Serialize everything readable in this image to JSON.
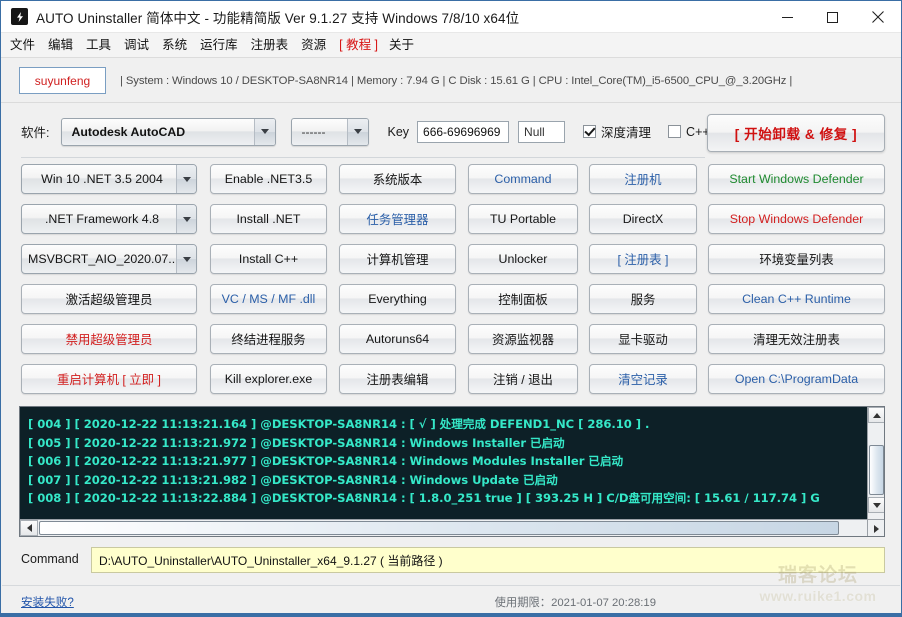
{
  "window": {
    "title": "AUTO Uninstaller 简体中文 - 功能精简版 Ver 9.1.27 支持 Windows 7/8/10 x64位",
    "icon": "lightning-bolt-icon",
    "minimize_label": "minimize-icon",
    "maximize_label": "maximize-icon",
    "close_label": "close-icon"
  },
  "menubar": {
    "items": [
      {
        "label": "文件",
        "accent": false
      },
      {
        "label": "编辑",
        "accent": false
      },
      {
        "label": "工具",
        "accent": false
      },
      {
        "label": "调试",
        "accent": false
      },
      {
        "label": "系统",
        "accent": false
      },
      {
        "label": "运行库",
        "accent": false
      },
      {
        "label": "注册表",
        "accent": false
      },
      {
        "label": "资源",
        "accent": false
      },
      {
        "label": "[ 教程 ]",
        "accent": true
      },
      {
        "label": "关于",
        "accent": false
      }
    ]
  },
  "infostrip": {
    "username": "suyunfeng",
    "system_info": "|  System : Windows 10  /  DESKTOP-SA8NR14  |  Memory : 7.94 G |  C Disk : 15.61 G  |  CPU : Intel_Core(TM)_i5-6500_CPU_@_3.20GHz  |"
  },
  "selector_row": {
    "software_label": "软件:",
    "software_value": "Autodesk AutoCAD",
    "version_value": "------",
    "key_label": "Key",
    "key_value": "666-69696969",
    "null_value": "Null",
    "deep_clean_label": "深度清理",
    "deep_clean_checked": true,
    "cpp_label": "C++",
    "cpp_checked": false,
    "start_button": "[ 开始卸载 & 修复 ]"
  },
  "grid": {
    "rows": [
      {
        "cells": [
          {
            "type": "combo",
            "label": "Win 10 .NET 3.5 2004",
            "color": "default"
          },
          {
            "type": "button",
            "label": "Enable .NET3.5",
            "color": "default"
          },
          {
            "type": "button",
            "label": "系统版本",
            "color": "default"
          },
          {
            "type": "button",
            "label": "Command",
            "color": "blue"
          },
          {
            "type": "button",
            "label": "注册机",
            "color": "blue"
          },
          {
            "type": "button",
            "label": "Start  Windows Defender",
            "color": "green"
          }
        ]
      },
      {
        "cells": [
          {
            "type": "combo",
            "label": ".NET Framework 4.8",
            "color": "default"
          },
          {
            "type": "button",
            "label": "Install .NET",
            "color": "default"
          },
          {
            "type": "button",
            "label": "任务管理器",
            "color": "blue"
          },
          {
            "type": "button",
            "label": "TU Portable",
            "color": "default"
          },
          {
            "type": "button",
            "label": "DirectX",
            "color": "default"
          },
          {
            "type": "button",
            "label": "Stop  Windows Defender",
            "color": "red"
          }
        ]
      },
      {
        "cells": [
          {
            "type": "combo",
            "label": "MSVBCRT_AIO_2020.07....",
            "color": "default"
          },
          {
            "type": "button",
            "label": "Install C++",
            "color": "default"
          },
          {
            "type": "button",
            "label": "计算机管理",
            "color": "default"
          },
          {
            "type": "button",
            "label": "Unlocker",
            "color": "default"
          },
          {
            "type": "button",
            "label": "[  注册表  ]",
            "color": "blue"
          },
          {
            "type": "button",
            "label": "环境变量列表",
            "color": "default"
          }
        ]
      },
      {
        "cells": [
          {
            "type": "button",
            "label": "激活超级管理员",
            "color": "default"
          },
          {
            "type": "button",
            "label": "VC / MS / MF .dll",
            "color": "blue"
          },
          {
            "type": "button",
            "label": "Everything",
            "color": "default"
          },
          {
            "type": "button",
            "label": "控制面板",
            "color": "default"
          },
          {
            "type": "button",
            "label": "服务",
            "color": "default"
          },
          {
            "type": "button",
            "label": "Clean C++ Runtime",
            "color": "blue"
          }
        ]
      },
      {
        "cells": [
          {
            "type": "button",
            "label": "禁用超级管理员",
            "color": "red"
          },
          {
            "type": "button",
            "label": "终结进程服务",
            "color": "default"
          },
          {
            "type": "button",
            "label": "Autoruns64",
            "color": "default"
          },
          {
            "type": "button",
            "label": "资源监视器",
            "color": "default"
          },
          {
            "type": "button",
            "label": "显卡驱动",
            "color": "default"
          },
          {
            "type": "button",
            "label": "清理无效注册表",
            "color": "default"
          }
        ]
      },
      {
        "cells": [
          {
            "type": "button",
            "label": "重启计算机 [ 立即 ]",
            "color": "red"
          },
          {
            "type": "button",
            "label": "Kill explorer.exe",
            "color": "default"
          },
          {
            "type": "button",
            "label": "注册表编辑",
            "color": "default"
          },
          {
            "type": "button",
            "label": "注销 / 退出",
            "color": "default"
          },
          {
            "type": "button",
            "label": "清空记录",
            "color": "blue"
          },
          {
            "type": "button",
            "label": "Open C:\\ProgramData",
            "color": "blue"
          }
        ]
      }
    ]
  },
  "console": {
    "lines": [
      "[ 004 ] [ 2020-12-22 11:13:21.164 ] @DESKTOP-SA8NR14 : [ √ ] 处理完成 DEFEND1_NC [ 286.10 ] .",
      "[ 005 ] [ 2020-12-22 11:13:21.972 ] @DESKTOP-SA8NR14 : Windows Installer 已启动",
      "[ 006 ] [ 2020-12-22 11:13:21.977 ] @DESKTOP-SA8NR14 : Windows Modules Installer 已启动",
      "[ 007 ] [ 2020-12-22 11:13:21.982 ] @DESKTOP-SA8NR14 : Windows Update 已启动",
      "[ 008 ] [ 2020-12-22 11:13:22.884 ] @DESKTOP-SA8NR14 : [ 1.8.0_251 true ] [ 393.25 H ] C/D盘可用空间: [ 15.61 / 117.74 ] G"
    ],
    "text_color": "#35e8c8",
    "background_color": "#0d2027"
  },
  "command_row": {
    "label": "Command",
    "value": "D:\\AUTO_Uninstaller\\AUTO_Uninstaller_x64_9.1.27 ( 当前路径 )"
  },
  "statusbar": {
    "left_link": "安装失败?",
    "right_text": "使用期限：2021-01-07 20:28:19",
    "watermark_line1": "瑞客论坛",
    "watermark_line2": "www.ruike1.com"
  }
}
